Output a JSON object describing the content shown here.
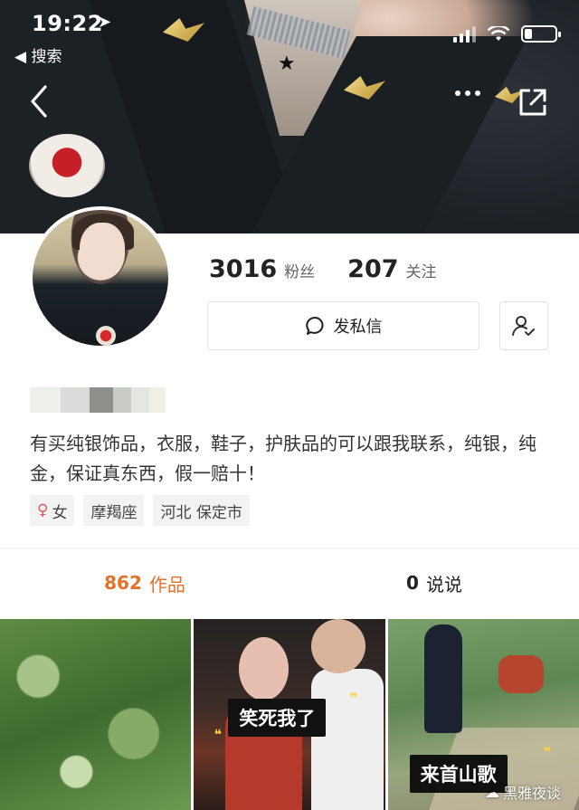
{
  "status_bar": {
    "time": "19:22",
    "back_app_label": "◀ 搜索",
    "battery_level": 0.25
  },
  "profile": {
    "followers_count": "3016",
    "followers_label": "粉丝",
    "following_count": "207",
    "following_label": "关注",
    "message_button_label": "发私信",
    "bio": "有买纯银饰品，衣服，鞋子，护肤品的可以跟我联系，纯银，纯金，保证真东西，假一赔十！",
    "tags": [
      {
        "icon": "female-icon",
        "label": "女"
      },
      {
        "label": "摩羯座"
      },
      {
        "label": "河北 保定市"
      }
    ]
  },
  "tabs": {
    "works_count": "862",
    "works_label": "作品",
    "posts_count": "0",
    "posts_label": "说说",
    "active_color": "#e8712a"
  },
  "grid": {
    "captions": [
      "笑死我了",
      "来首山歌"
    ]
  },
  "watermark": {
    "text": "黑雅夜谈"
  }
}
